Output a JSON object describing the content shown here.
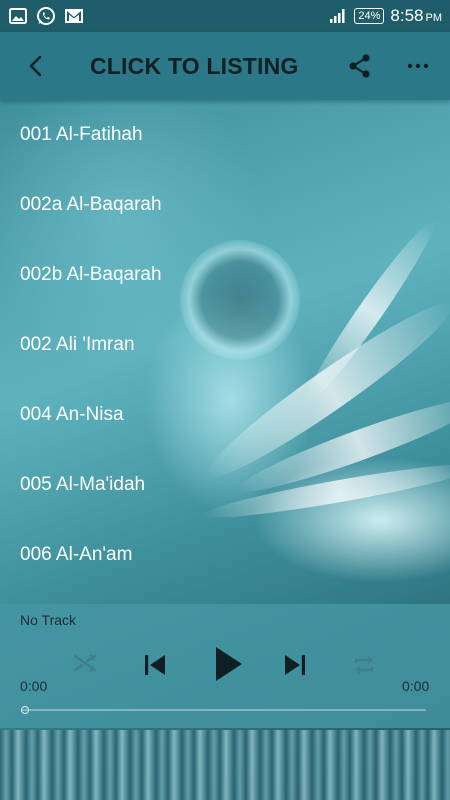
{
  "status_bar": {
    "battery": "24%",
    "time": "8:58",
    "ampm": "PM",
    "icons": [
      "image-icon",
      "whatsapp-icon",
      "gmail-icon",
      "signal-icon",
      "battery-icon"
    ]
  },
  "app_bar": {
    "title": "CLICK TO LISTING",
    "back_icon": "back-arrow-icon",
    "share_icon": "share-icon",
    "more_icon": "more-horizontal-icon"
  },
  "tracks": [
    "001 Al-Fatihah",
    "002a Al-Baqarah",
    "002b Al-Baqarah",
    "002 Ali 'Imran",
    "004 An-Nisa",
    "005 Al-Ma'idah",
    "006 Al-An'am"
  ],
  "player": {
    "track_name": "No Track",
    "current_time": "0:00",
    "total_time": "0:00",
    "progress": 0,
    "controls": [
      "shuffle-icon",
      "previous-icon",
      "play-icon",
      "next-icon",
      "repeat-icon"
    ]
  },
  "colors": {
    "status_bar": "#1f5d6a",
    "app_bar": "#2b7889",
    "title_text": "#0f1f24",
    "list_text": "#ffffff",
    "player_bg": "#4696a5"
  }
}
